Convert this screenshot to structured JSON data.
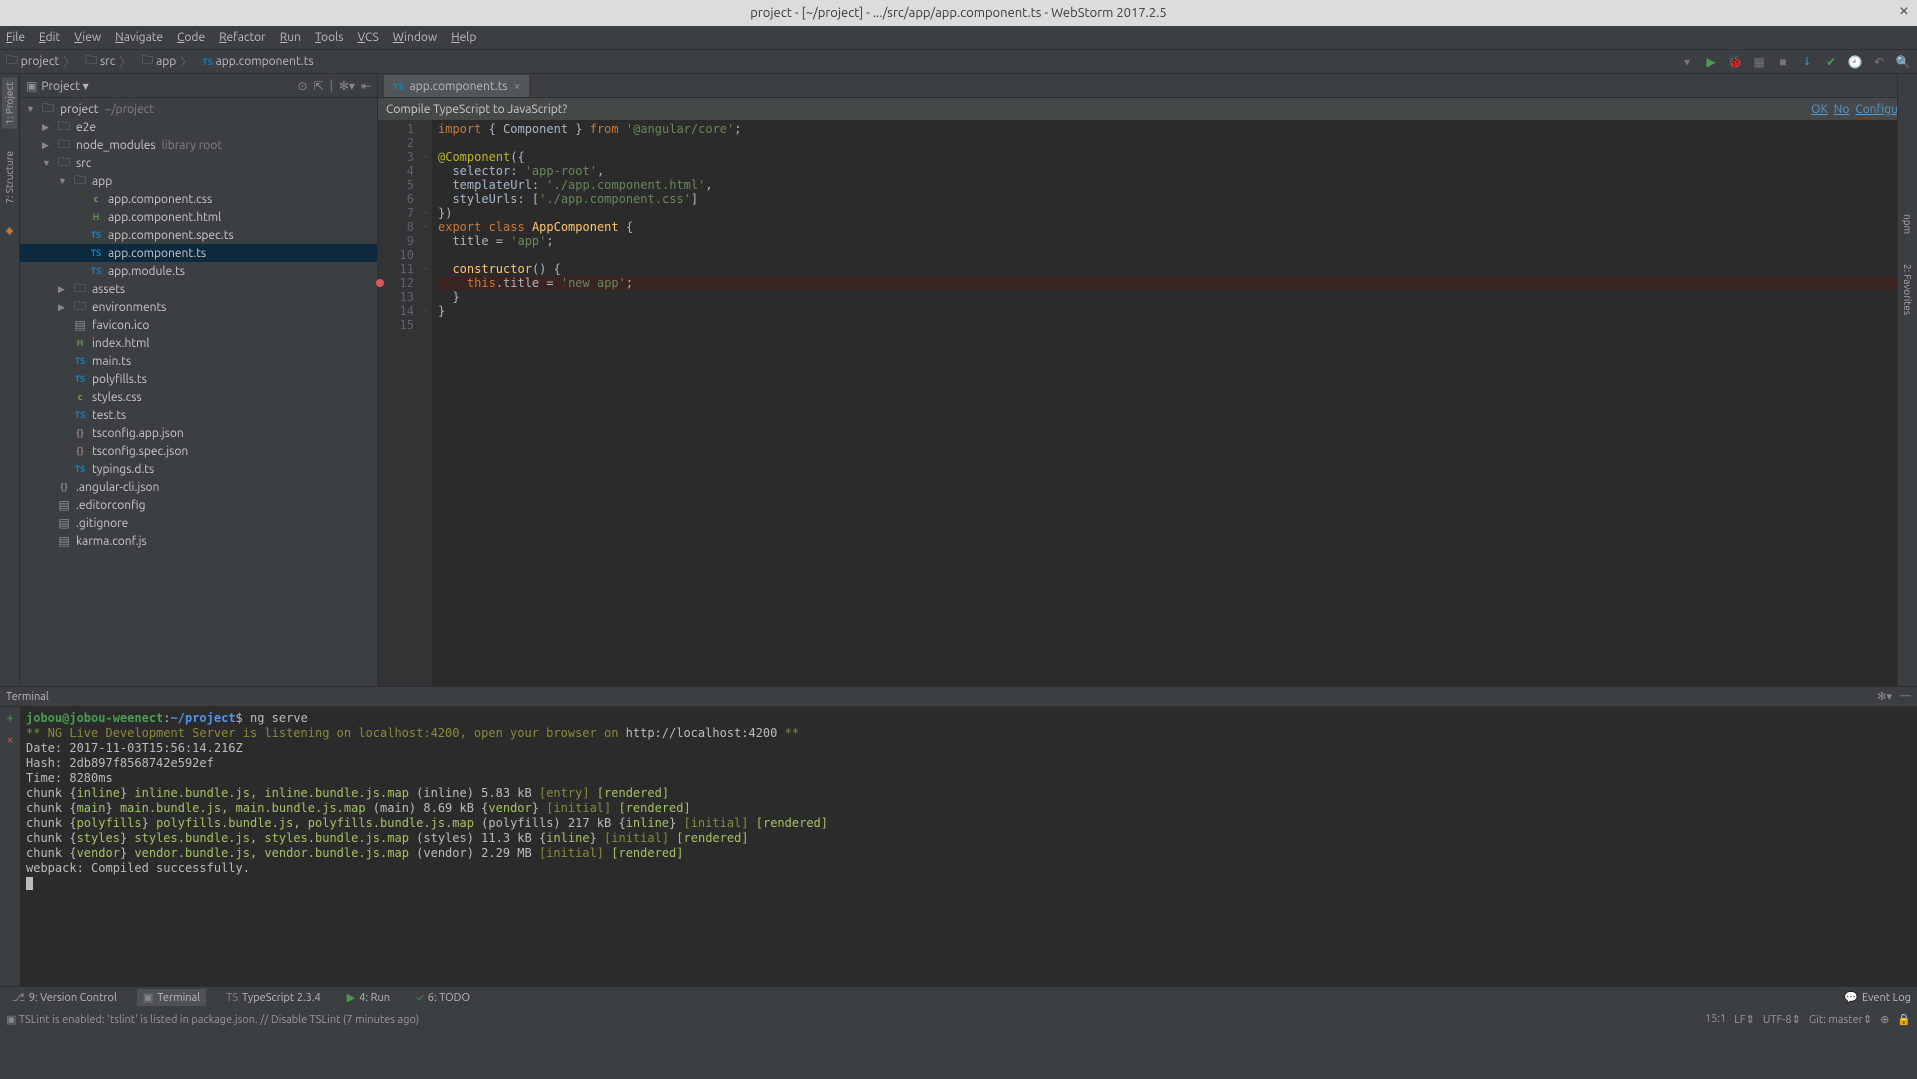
{
  "title": "project - [~/project] - .../src/app/app.component.ts - WebStorm 2017.2.5",
  "menus": [
    "File",
    "Edit",
    "View",
    "Navigate",
    "Code",
    "Refactor",
    "Run",
    "Tools",
    "VCS",
    "Window",
    "Help"
  ],
  "breadcrumbs": [
    {
      "icon": "folder",
      "label": "project"
    },
    {
      "icon": "folder",
      "label": "src"
    },
    {
      "icon": "folder",
      "label": "app"
    },
    {
      "icon": "ts",
      "label": "app.component.ts"
    }
  ],
  "toolbarRight": [
    "dropdown",
    "run",
    "debug",
    "coverage",
    "stop",
    "sep",
    "update",
    "commit",
    "history",
    "revert",
    "sep",
    "search"
  ],
  "projectPanel": {
    "title": "Project",
    "headerIcons": [
      "target",
      "autoscroll",
      "divider",
      "settings",
      "hide"
    ]
  },
  "tree": [
    {
      "depth": 0,
      "arrow": "down",
      "icon": "folder",
      "name": "project",
      "hint": "~/project"
    },
    {
      "depth": 1,
      "arrow": "right",
      "icon": "folder",
      "name": "e2e"
    },
    {
      "depth": 1,
      "arrow": "right",
      "icon": "folder",
      "name": "node_modules",
      "hint": "library root"
    },
    {
      "depth": 1,
      "arrow": "down",
      "icon": "folder",
      "name": "src"
    },
    {
      "depth": 2,
      "arrow": "down",
      "icon": "folder",
      "name": "app"
    },
    {
      "depth": 3,
      "arrow": "",
      "icon": "css",
      "name": "app.component.css"
    },
    {
      "depth": 3,
      "arrow": "",
      "icon": "html",
      "name": "app.component.html"
    },
    {
      "depth": 3,
      "arrow": "",
      "icon": "ts",
      "name": "app.component.spec.ts"
    },
    {
      "depth": 3,
      "arrow": "",
      "icon": "ts",
      "name": "app.component.ts",
      "selected": true
    },
    {
      "depth": 3,
      "arrow": "",
      "icon": "ts",
      "name": "app.module.ts"
    },
    {
      "depth": 2,
      "arrow": "right",
      "icon": "folder",
      "name": "assets"
    },
    {
      "depth": 2,
      "arrow": "right",
      "icon": "folder",
      "name": "environments"
    },
    {
      "depth": 2,
      "arrow": "",
      "icon": "file",
      "name": "favicon.ico"
    },
    {
      "depth": 2,
      "arrow": "",
      "icon": "html",
      "name": "index.html"
    },
    {
      "depth": 2,
      "arrow": "",
      "icon": "ts",
      "name": "main.ts"
    },
    {
      "depth": 2,
      "arrow": "",
      "icon": "ts",
      "name": "polyfills.ts"
    },
    {
      "depth": 2,
      "arrow": "",
      "icon": "css",
      "name": "styles.css"
    },
    {
      "depth": 2,
      "arrow": "",
      "icon": "ts",
      "name": "test.ts"
    },
    {
      "depth": 2,
      "arrow": "",
      "icon": "json",
      "name": "tsconfig.app.json"
    },
    {
      "depth": 2,
      "arrow": "",
      "icon": "json",
      "name": "tsconfig.spec.json"
    },
    {
      "depth": 2,
      "arrow": "",
      "icon": "ts",
      "name": "typings.d.ts"
    },
    {
      "depth": 1,
      "arrow": "",
      "icon": "json",
      "name": ".angular-cli.json"
    },
    {
      "depth": 1,
      "arrow": "",
      "icon": "file",
      "name": ".editorconfig"
    },
    {
      "depth": 1,
      "arrow": "",
      "icon": "file",
      "name": ".gitignore"
    },
    {
      "depth": 1,
      "arrow": "",
      "icon": "file",
      "name": "karma.conf.js"
    }
  ],
  "sideTabs": [
    {
      "label": "1: Project",
      "active": true
    },
    {
      "label": "7: Structure",
      "active": false
    }
  ],
  "editorTab": {
    "label": "app.component.ts"
  },
  "compilePrompt": {
    "text": "Compile TypeScript to JavaScript?",
    "links": [
      "OK",
      "No",
      "Configure"
    ]
  },
  "code": {
    "lines": 15,
    "breakpointLine": 12,
    "tokens": [
      [
        {
          "t": "import",
          "c": "kw"
        },
        {
          "t": " { Component } "
        },
        {
          "t": "from",
          "c": "kw"
        },
        {
          "t": " "
        },
        {
          "t": "'@angular/core'",
          "c": "str"
        },
        {
          "t": ";"
        }
      ],
      [],
      [
        {
          "t": "@Component",
          "c": "ann"
        },
        {
          "t": "({"
        }
      ],
      [
        {
          "t": "  selector: "
        },
        {
          "t": "'app-root'",
          "c": "str"
        },
        {
          "t": ","
        }
      ],
      [
        {
          "t": "  templateUrl: "
        },
        {
          "t": "'./app.component.html'",
          "c": "str"
        },
        {
          "t": ","
        }
      ],
      [
        {
          "t": "  styleUrls: ["
        },
        {
          "t": "'./app.component.css'",
          "c": "str"
        },
        {
          "t": "]"
        }
      ],
      [
        {
          "t": "})"
        }
      ],
      [
        {
          "t": "export ",
          "c": "kw"
        },
        {
          "t": "class ",
          "c": "kw"
        },
        {
          "t": "AppComponent",
          "c": "id"
        },
        {
          "t": " {"
        }
      ],
      [
        {
          "t": "  title = "
        },
        {
          "t": "'app'",
          "c": "str"
        },
        {
          "t": ";"
        }
      ],
      [],
      [
        {
          "t": "  constructor() {",
          "c": "id2"
        }
      ],
      [
        {
          "t": "    "
        },
        {
          "t": "this",
          "c": "thisc"
        },
        {
          "t": ".title = "
        },
        {
          "t": "'new app'",
          "c": "str"
        },
        {
          "t": ";"
        }
      ],
      [
        {
          "t": "  }"
        }
      ],
      [
        {
          "t": "}"
        }
      ],
      []
    ],
    "folds": [
      "",
      "",
      "-",
      "",
      "",
      "",
      "-",
      "-",
      "",
      "",
      "-",
      "",
      "",
      "-",
      ""
    ]
  },
  "terminal": {
    "title": "Terminal",
    "prompt": {
      "user": "jobou@jobou-weenect",
      "sep": ":",
      "path": "~/project",
      "sym": "$",
      "cmd": "ng serve"
    },
    "raw": [
      {
        "segs": [
          {
            "t": "** NG Live Development Server is listening on localhost:4200, open your browser on ",
            "c": "tg"
          },
          {
            "t": "http://localhost:4200",
            "c": "tw"
          },
          {
            "t": " **",
            "c": "tg"
          }
        ]
      },
      {
        "segs": [
          {
            "t": "Date: 2017-11-03T15:56:14.216Z"
          }
        ]
      },
      {
        "segs": [
          {
            "t": "Hash: 2db897f8568742e592ef"
          }
        ]
      },
      {
        "segs": [
          {
            "t": "Time: 8280ms"
          }
        ]
      },
      {
        "segs": [
          {
            "t": "chunk {"
          },
          {
            "t": "inline",
            "c": "ty"
          },
          {
            "t": "} "
          },
          {
            "t": "inline.bundle.js, inline.bundle.js.map",
            "c": "ty"
          },
          {
            "t": " (inline) 5.83 kB "
          },
          {
            "t": "[entry]",
            "c": "tg"
          },
          {
            "t": " "
          },
          {
            "t": "[rendered]",
            "c": "ty"
          }
        ]
      },
      {
        "segs": [
          {
            "t": "chunk {"
          },
          {
            "t": "main",
            "c": "ty"
          },
          {
            "t": "} "
          },
          {
            "t": "main.bundle.js, main.bundle.js.map",
            "c": "ty"
          },
          {
            "t": " (main) 8.69 kB {"
          },
          {
            "t": "vendor",
            "c": "ty"
          },
          {
            "t": "} "
          },
          {
            "t": "[initial]",
            "c": "tg"
          },
          {
            "t": " "
          },
          {
            "t": "[rendered]",
            "c": "ty"
          }
        ]
      },
      {
        "segs": [
          {
            "t": "chunk {"
          },
          {
            "t": "polyfills",
            "c": "ty"
          },
          {
            "t": "} "
          },
          {
            "t": "polyfills.bundle.js, polyfills.bundle.js.map",
            "c": "ty"
          },
          {
            "t": " (polyfills) 217 kB {"
          },
          {
            "t": "inline",
            "c": "ty"
          },
          {
            "t": "} "
          },
          {
            "t": "[initial]",
            "c": "tg"
          },
          {
            "t": " "
          },
          {
            "t": "[rendered]",
            "c": "ty"
          }
        ]
      },
      {
        "segs": [
          {
            "t": "chunk {"
          },
          {
            "t": "styles",
            "c": "ty"
          },
          {
            "t": "} "
          },
          {
            "t": "styles.bundle.js, styles.bundle.js.map",
            "c": "ty"
          },
          {
            "t": " (styles) 11.3 kB {"
          },
          {
            "t": "inline",
            "c": "ty"
          },
          {
            "t": "} "
          },
          {
            "t": "[initial]",
            "c": "tg"
          },
          {
            "t": " "
          },
          {
            "t": "[rendered]",
            "c": "ty"
          }
        ]
      },
      {
        "segs": [
          {
            "t": "chunk {"
          },
          {
            "t": "vendor",
            "c": "ty"
          },
          {
            "t": "} "
          },
          {
            "t": "vendor.bundle.js, vendor.bundle.js.map",
            "c": "ty"
          },
          {
            "t": " (vendor) 2.29 MB "
          },
          {
            "t": "[initial]",
            "c": "tg"
          },
          {
            "t": " "
          },
          {
            "t": "[rendered]",
            "c": "ty"
          }
        ]
      },
      {
        "segs": [
          {
            "t": ""
          }
        ]
      },
      {
        "segs": [
          {
            "t": "webpack: Compiled successfully."
          }
        ]
      }
    ]
  },
  "bottomTools": [
    {
      "icon": "vcs",
      "label": "9: Version Control"
    },
    {
      "icon": "term",
      "label": "Terminal",
      "active": true
    },
    {
      "icon": "ts",
      "label": "TypeScript 2.3.4"
    },
    {
      "icon": "run",
      "label": "4: Run"
    },
    {
      "icon": "todo",
      "label": "6: TODO"
    }
  ],
  "eventLog": "Event Log",
  "status": {
    "left": "TSLint is enabled: 'tslint' is listed in package.json. // Disable TSLint (7 minutes ago)",
    "right": [
      "15:1",
      "LF⇕",
      "UTF-8⇕",
      "Git: master⇕",
      "⊕",
      "🔒"
    ]
  },
  "rightGutter": {
    "tabs": [
      "npm",
      "2: Favorites"
    ]
  }
}
